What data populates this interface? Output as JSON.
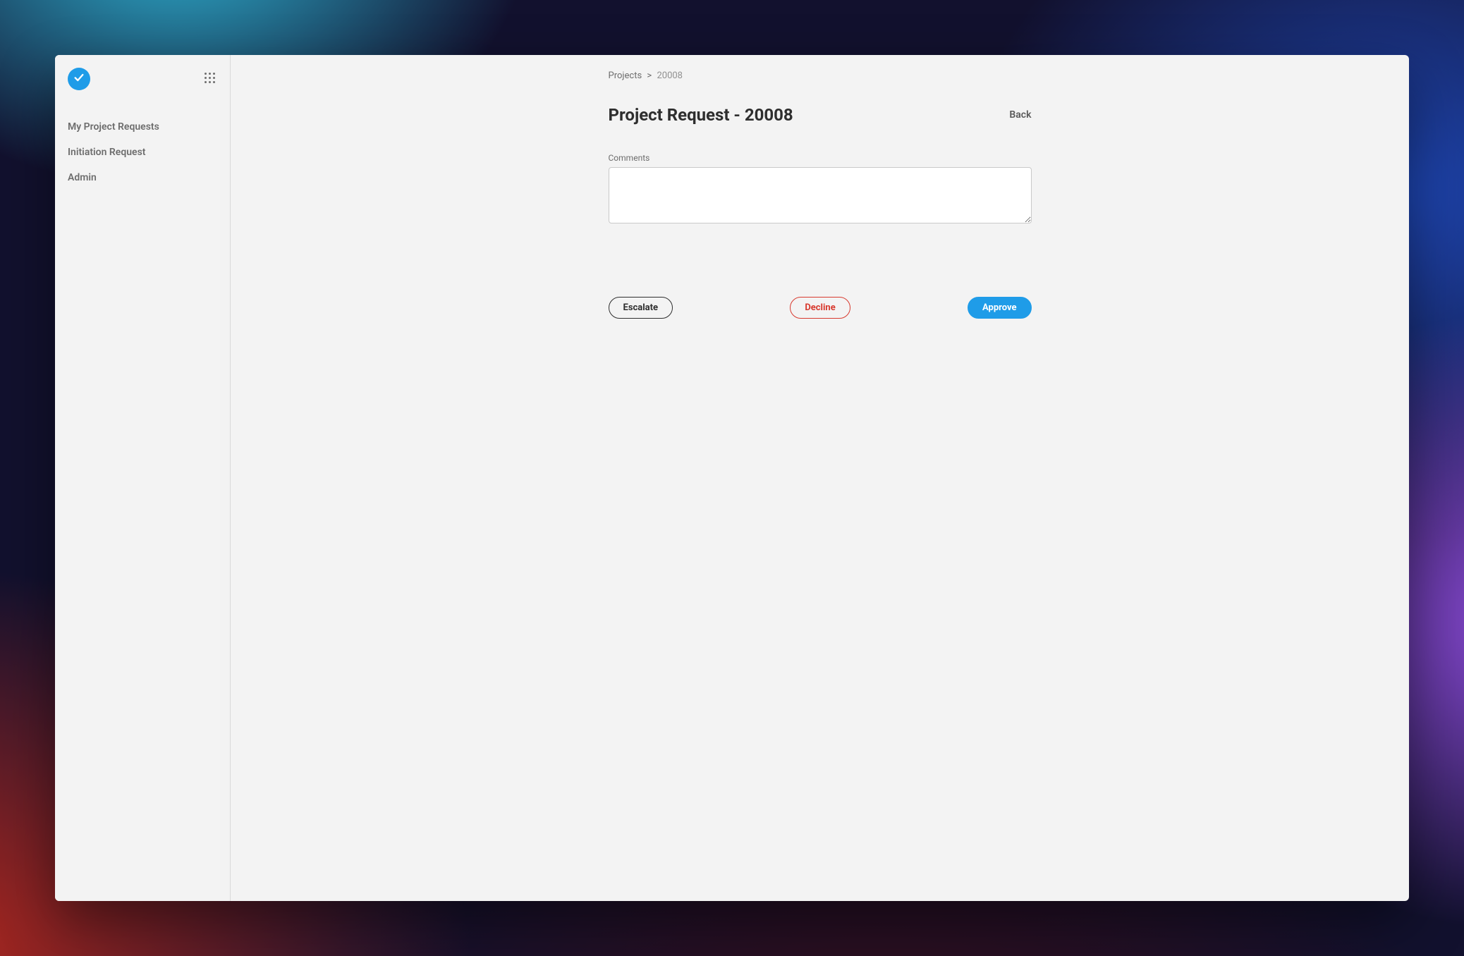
{
  "sidebar": {
    "nav": [
      {
        "label": "My Project Requests"
      },
      {
        "label": "Initiation Request"
      },
      {
        "label": "Admin"
      }
    ]
  },
  "breadcrumb": {
    "root": "Projects",
    "separator": ">",
    "current": "20008"
  },
  "header": {
    "title": "Project Request - 20008",
    "back_label": "Back"
  },
  "form": {
    "comments_label": "Comments",
    "comments_value": ""
  },
  "actions": {
    "escalate": "Escalate",
    "decline": "Decline",
    "approve": "Approve"
  },
  "colors": {
    "accent_primary": "#1f9ce8",
    "accent_danger": "#d83a2f",
    "text_muted": "#6d6d6d"
  }
}
